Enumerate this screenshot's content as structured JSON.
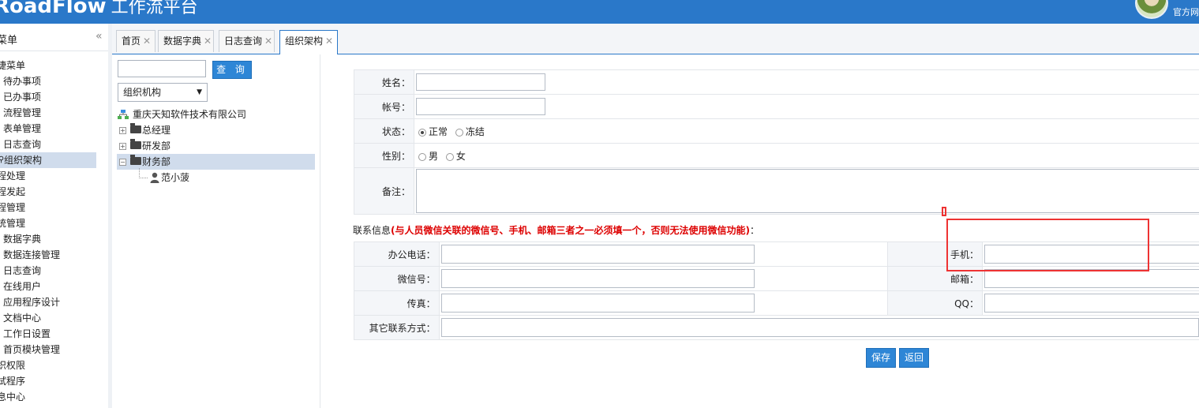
{
  "header": {
    "logo_main": "RoadFlow",
    "logo_sub": "工作流平台",
    "official_link": "官方网"
  },
  "sidebar": {
    "title": "菜单",
    "collapse_icon": "double-chevron-left-icon",
    "items": [
      {
        "label": "快捷菜单",
        "visible": "捷菜单"
      },
      {
        "label": "待办事项",
        "visible": "待办事项"
      },
      {
        "label": "已办事项",
        "visible": "已办事项"
      },
      {
        "label": "流程管理",
        "visible": "流程管理"
      },
      {
        "label": "表单管理",
        "visible": "表单管理"
      },
      {
        "label": "日志查询",
        "visible": "日志查询"
      },
      {
        "label": "组织架构",
        "visible": "组织架构"
      },
      {
        "label": "流程处理",
        "visible": "程处理"
      },
      {
        "label": "流程发起",
        "visible": "程发起"
      },
      {
        "label": "流程管理",
        "visible": "程管理"
      },
      {
        "label": "系统管理",
        "visible": "统管理"
      },
      {
        "label": "数据字典",
        "visible": "数据字典"
      },
      {
        "label": "数据连接管理",
        "visible": "数据连接管理"
      },
      {
        "label": "日志查询",
        "visible": "日志查询"
      },
      {
        "label": "在线用户",
        "visible": "在线用户"
      },
      {
        "label": "应用程序设计",
        "visible": "应用程序设计"
      },
      {
        "label": "文档中心",
        "visible": "文档中心"
      },
      {
        "label": "工作日设置",
        "visible": "工作日设置"
      },
      {
        "label": "首页模块管理",
        "visible": "首页模块管理"
      },
      {
        "label": "组织权限",
        "visible": "织权限"
      },
      {
        "label": "测试程序",
        "visible": "试程序"
      },
      {
        "label": "消息中心",
        "visible": "息中心"
      }
    ]
  },
  "tabs": [
    {
      "label": "首页"
    },
    {
      "label": "数据字典"
    },
    {
      "label": "日志查询"
    },
    {
      "label": "组织架构"
    }
  ],
  "tree_panel": {
    "search_placeholder": "",
    "query_label": "查 询",
    "select_value": "组织机构",
    "root": "重庆天知软件技术有限公司",
    "nodes": [
      {
        "label": "总经理",
        "expander": "+"
      },
      {
        "label": "研发部",
        "expander": "+"
      },
      {
        "label": "财务部",
        "expander": "−"
      }
    ],
    "leaf": "范小菠"
  },
  "form": {
    "name_label": "姓名：",
    "account_label": "帐号：",
    "status_label": "状态：",
    "status_options": [
      "正常",
      "冻结"
    ],
    "gender_label": "性别：",
    "gender_options": [
      "男",
      "女"
    ],
    "remark_label": "备注：",
    "contact_title": "联系信息",
    "contact_warning": "(与人员微信关联的微信号、手机、邮箱三者之一必须填一个，否则无法使用微信功能)",
    "contact_colon": "：",
    "office_phone_label": "办公电话：",
    "mobile_label": "手机：",
    "wechat_label": "微信号：",
    "email_label": "邮箱：",
    "fax_label": "传真：",
    "qq_label": "QQ：",
    "other_label": "其它联系方式：",
    "save_label": "保存",
    "back_label": "返回"
  },
  "colors": {
    "header_blue": "#2a78c9",
    "button_blue": "#2e86d6",
    "warning_red": "#dd0000",
    "highlight_red": "#ee3333"
  }
}
